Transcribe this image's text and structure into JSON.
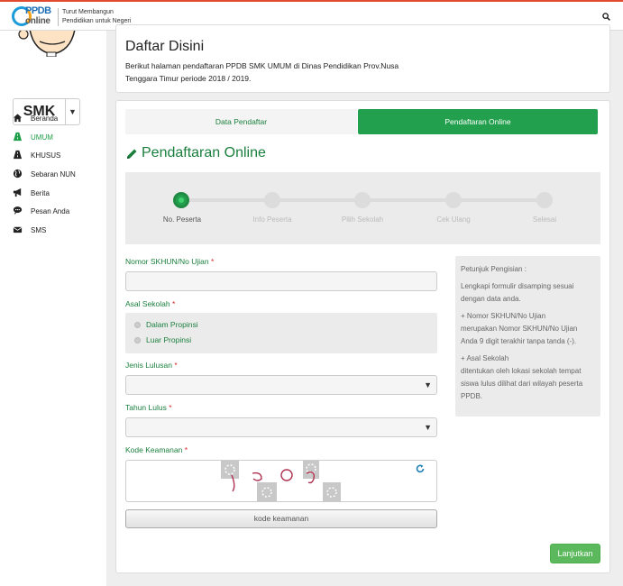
{
  "header": {
    "logo": {
      "line1": "PPDB",
      "line2": "online"
    },
    "tagline_line1": "Turut Membangun",
    "tagline_line2": "Pendidikan untuk Negeri",
    "search_icon": "search-icon"
  },
  "sidebar": {
    "level_select": "SMK",
    "items": [
      {
        "label": "Beranda",
        "icon": "home-icon",
        "active": false
      },
      {
        "label": "UMUM",
        "icon": "road-icon",
        "active": true
      },
      {
        "label": "KHUSUS",
        "icon": "road-icon",
        "active": false
      },
      {
        "label": "Sebaran NUN",
        "icon": "globe-icon",
        "active": false
      },
      {
        "label": "Berita",
        "icon": "bullhorn-icon",
        "active": false
      },
      {
        "label": "Pesan Anda",
        "icon": "chat-icon",
        "active": false
      },
      {
        "label": "SMS",
        "icon": "envelope-icon",
        "active": false
      }
    ]
  },
  "page": {
    "title": "Daftar Disini",
    "description": "Berikut halaman pendaftaran PPDB SMK UMUM di Dinas Pendidikan Prov.Nusa Tenggara Timur periode 2018 / 2019."
  },
  "tabs": [
    {
      "label": "Data Pendaftar",
      "active": false
    },
    {
      "label": "Pendaftaran Online",
      "active": true
    }
  ],
  "section_title": "Pendaftaran Online",
  "steps": [
    {
      "label": "No. Peserta",
      "done": true
    },
    {
      "label": "Info Peserta",
      "done": false
    },
    {
      "label": "Pilih Sekolah",
      "done": false
    },
    {
      "label": "Cek Ulang",
      "done": false
    },
    {
      "label": "Selesai",
      "done": false
    }
  ],
  "form": {
    "nomor_label": "Nomor SKHUN/No Ujian",
    "asal_label": "Asal Sekolah",
    "asal_options": [
      "Dalam Propinsi",
      "Luar Propinsi"
    ],
    "jenis_label": "Jenis Lulusan",
    "tahun_label": "Tahun Lulus",
    "kode_label": "Kode Keamanan",
    "kode_button": "kode keamanan",
    "required_mark": "*",
    "submit": "Lanjutkan"
  },
  "help": {
    "title": "Petunjuk Pengisian :",
    "intro": "Lengkapi formulir disamping sesuai dengan data anda.",
    "item1_title": "+ Nomor SKHUN/No Ujian",
    "item1_text": "merupakan Nomor SKHUN/No Ujian Anda 9 digit terakhir tanpa tanda (-).",
    "item2_title": "+ Asal Sekolah",
    "item2_text": "ditentukan oleh lokasi sekolah tempat siswa lulus dilihat dari wilayah peserta PPDB."
  },
  "colors": {
    "accent_green": "#22a04d",
    "header_border": "#e14a2e",
    "required": "#d42b2b"
  }
}
